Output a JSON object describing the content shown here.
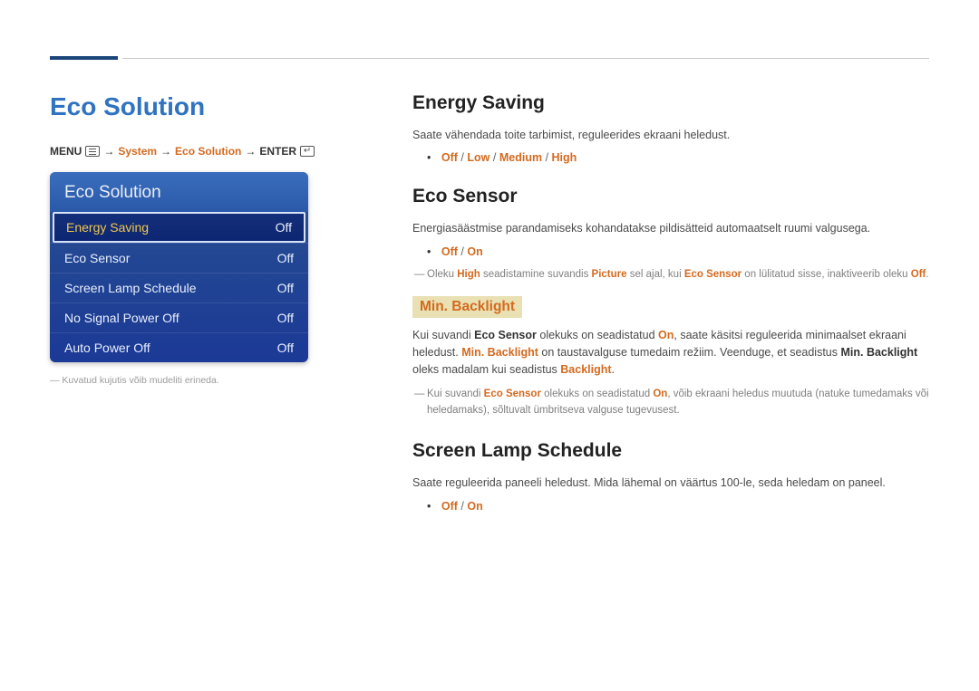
{
  "page_title": "Eco Solution",
  "breadcrumb": {
    "menu": "MENU",
    "arrow": "→",
    "p1": "System",
    "p2": "Eco Solution",
    "enter": "ENTER"
  },
  "menu": {
    "header": "Eco Solution",
    "items": [
      {
        "label": "Energy Saving",
        "value": "Off",
        "selected": true
      },
      {
        "label": "Eco Sensor",
        "value": "Off",
        "selected": false
      },
      {
        "label": "Screen Lamp Schedule",
        "value": "Off",
        "selected": false
      },
      {
        "label": "No Signal Power Off",
        "value": "Off",
        "selected": false
      },
      {
        "label": "Auto Power Off",
        "value": "Off",
        "selected": false
      }
    ]
  },
  "footnote": "Kuvatud kujutis võib mudeliti erineda.",
  "sections": {
    "energy_saving": {
      "title": "Energy Saving",
      "desc": "Saate vähendada toite tarbimist, reguleerides ekraani heledust.",
      "opts": [
        "Off",
        "Low",
        "Medium",
        "High"
      ]
    },
    "eco_sensor": {
      "title": "Eco Sensor",
      "desc": "Energiasäästmise parandamiseks kohandatakse pildisätteid automaatselt ruumi valgusega.",
      "opts": [
        "Off",
        "On"
      ],
      "note1_a": "Oleku ",
      "note1_b": "High",
      "note1_c": " seadistamine suvandis ",
      "note1_d": "Picture",
      "note1_e": " sel ajal, kui ",
      "note1_f": "Eco Sensor",
      "note1_g": " on lülitatud sisse, inaktiveerib oleku ",
      "note1_h": "Off",
      "note1_i": ".",
      "sub": {
        "title": "Min. Backlight",
        "p_a": "Kui suvandi ",
        "p_b": "Eco Sensor",
        "p_c": " olekuks on seadistatud ",
        "p_d": "On",
        "p_e": ", saate käsitsi reguleerida minimaalset ekraani heledust. ",
        "p_f": "Min. Backlight",
        "p_g": " on taustavalguse tumedaim režiim. Veenduge, et seadistus ",
        "p_h": "Min. Backlight",
        "p_i": " oleks madalam kui seadistus ",
        "p_j": "Backlight",
        "p_k": ".",
        "n_a": "Kui suvandi ",
        "n_b": "Eco Sensor",
        "n_c": " olekuks on seadistatud ",
        "n_d": "On",
        "n_e": ", võib ekraani heledus muutuda (natuke tumedamaks või heledamaks), sõltuvalt ümbritseva valguse tugevusest."
      }
    },
    "screen_lamp": {
      "title": "Screen Lamp Schedule",
      "desc": "Saate reguleerida paneeli heledust. Mida lähemal on väärtus 100-le, seda heledam on paneel.",
      "opts": [
        "Off",
        "On"
      ]
    }
  }
}
